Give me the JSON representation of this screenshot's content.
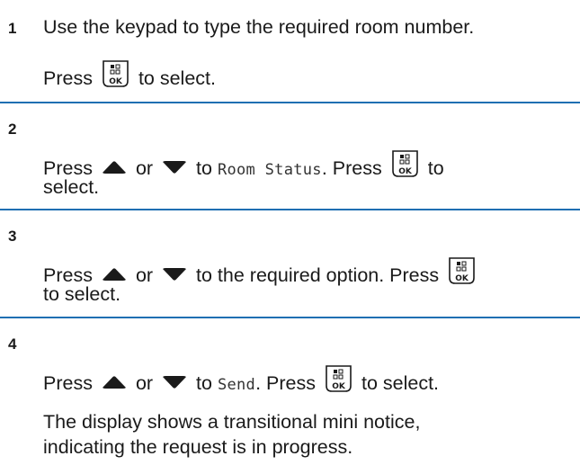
{
  "steps": [
    {
      "number": "1",
      "line1": "Use the keypad to type the required room number.",
      "press": "Press",
      "to_select": "to select."
    },
    {
      "number": "2",
      "press": "Press",
      "or": "or",
      "to": "to",
      "target": "Room Status",
      "press2": ". Press",
      "to_tail": "to",
      "line2": "select."
    },
    {
      "number": "3",
      "press": "Press",
      "or": "or",
      "rest": "to the required option. Press",
      "line2": "to select."
    },
    {
      "number": "4",
      "press": "Press",
      "or": "or",
      "to": "to",
      "target": "Send",
      "press2": ". Press",
      "to_select": "to select.",
      "note1": "The display shows a transitional mini notice,",
      "note2": "indicating the request is in progress."
    }
  ],
  "icons": {
    "ok_key": "menu-ok-key-icon",
    "up": "up-arrow-icon",
    "down": "down-arrow-icon"
  },
  "ok_key_label": "OK",
  "accent_color": "#1f6fb2"
}
